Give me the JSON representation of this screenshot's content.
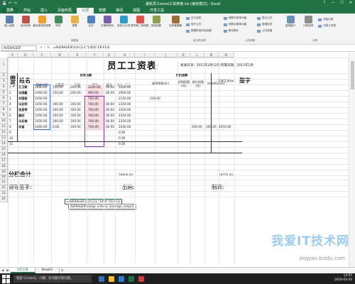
{
  "window": {
    "title": "最新员工excel工资表格.xls [兼容模式] - Excel",
    "qat_icons": [
      "save-icon",
      "undo-icon",
      "redo-icon"
    ],
    "controls": [
      "?",
      "—",
      "☐",
      "✕"
    ]
  },
  "ribbon_tabs": [
    "文件",
    "开始",
    "插入",
    "页面布局",
    "公式",
    "数据",
    "审阅",
    "视图",
    "开发工具"
  ],
  "ribbon_active_tab": "公式",
  "ribbon": {
    "buttons": [
      "插入函数",
      "自动求和",
      "最近使用的函数",
      "财务",
      "逻辑",
      "文本",
      "日期和时间",
      "查找与引用",
      "数学和三角函数",
      "其他函数",
      "名称管理器"
    ],
    "small_items": [
      "定义名称",
      "用于公式",
      "根据所选内容创建",
      "追踪引用单元格",
      "追踪从属单元格",
      "移去箭头",
      "显示公式",
      "错误检查",
      "公式求值",
      "监视窗口",
      "计算选项",
      "开始计算",
      "计算工作表"
    ],
    "groups": [
      "函数库",
      "定义的名称",
      "公式审核",
      "计算"
    ]
  },
  "formula_bar": {
    "name_box": "AVERAGEIF",
    "formula": "=AVERAGEIF(C4:C13,\"1450\",F6:F13)"
  },
  "columns": [
    "A",
    "B",
    "C",
    "D",
    "E",
    "F",
    "G",
    "H",
    "I",
    "J",
    "K",
    "L",
    "M",
    "N"
  ],
  "rows": [
    "1",
    "2",
    "3",
    "4",
    "5",
    "6",
    "7",
    "8",
    "9",
    "10",
    "11",
    "12",
    "13",
    "14",
    "15",
    "16",
    "17",
    "18",
    "19",
    "20",
    "21",
    "22",
    "23",
    "24"
  ],
  "sheet": {
    "title": "员工工资表",
    "issue_date": "发放日期：2015年2月12日",
    "period": "所属日期：2015年1月",
    "headers": {
      "no": "编号",
      "name": "姓名",
      "pay_group": "应发金额",
      "base": "基本工资",
      "full": "全勤奖",
      "bonus": "补助",
      "perf": "奖金",
      "prize": "奖金",
      "total": "合计（元）",
      "deduct_group": "应扣金额",
      "absent": "请假扣款(元)",
      "late": "迟到扣款(元)",
      "other": "其它扣款(元)",
      "deduct_total": "应扣合计(元)",
      "actual": "实发工资(元)",
      "sign": "签字"
    },
    "rows": [
      {
        "no": "1",
        "name": "王卫朝",
        "base": "1460.00",
        "full": "150.00",
        "bonus": "200.00",
        "perf": "1200.00",
        "prize": "00.00",
        "total": "3300.00",
        "absent": "",
        "late": "",
        "other": "",
        "ded": "",
        "actual": ""
      },
      {
        "no": "2",
        "name": "马国鑫",
        "base": "1460.00",
        "full": "150.00",
        "bonus": "200.00",
        "perf": "900.00",
        "prize": "00.00",
        "total": "2950.00",
        "absent": "",
        "late": "",
        "other": "",
        "ded": "",
        "actual": ""
      },
      {
        "no": "3",
        "name": "刘国俊",
        "base": "1450.00",
        "full": "",
        "bonus": "",
        "perf": "700.00",
        "prize": "",
        "total": "2150.00",
        "absent": "330.00",
        "late": "",
        "other": "",
        "ded": "",
        "actual": ""
      },
      {
        "no": "4",
        "name": "马亚明",
        "base": "1450.00",
        "full": "100.00",
        "bonus": "100.00",
        "perf": "700.00",
        "prize": "00.00",
        "total": "2350.00",
        "absent": "",
        "late": "",
        "other": "",
        "ded": "",
        "actual": ""
      },
      {
        "no": "5",
        "name": "张爱琴",
        "base": "1450.00",
        "full": "100.00",
        "bonus": "100.00",
        "perf": "700.00",
        "prize": "00.00",
        "total": "2350.00",
        "absent": "",
        "late": "",
        "other": "",
        "ded": "",
        "actual": ""
      },
      {
        "no": "6",
        "name": "冀阳",
        "base": "1450.00",
        "full": "100.00",
        "bonus": "100.00",
        "perf": "700.00",
        "prize": "00.00",
        "total": "2350.00",
        "absent": "",
        "late": "",
        "other": "",
        "ded": "",
        "actual": ""
      },
      {
        "no": "7",
        "name": "马亚梅",
        "base": "1450.00",
        "full": "100.00",
        "bonus": "100.00",
        "perf": "700.00",
        "prize": "00.00",
        "total": "2350.00",
        "absent": "",
        "late": "",
        "other": "",
        "ded": "",
        "actual": ""
      },
      {
        "no": "8",
        "name": "邓睿",
        "base": "1460.00",
        "full": "0.00",
        "bonus": "100.00",
        "perf": "700.00",
        "prize": "00.00",
        "total": "2260.00",
        "absent": "",
        "late": "",
        "other": "200.00",
        "ded": "200.00",
        "actual": "2050.00"
      },
      {
        "no": "9",
        "name": "",
        "base": "",
        "full": "",
        "bonus": "",
        "perf": "",
        "prize": "",
        "total": "0.00",
        "absent": "",
        "late": "",
        "other": "",
        "ded": "",
        "actual": ""
      },
      {
        "no": "10",
        "name": "",
        "base": "",
        "full": "",
        "bonus": "",
        "perf": "",
        "prize": "",
        "total": "0.00",
        "absent": "",
        "late": "",
        "other": "",
        "ded": "",
        "actual": ""
      },
      {
        "no": "11",
        "name": "",
        "base": "",
        "full": "",
        "bonus": "",
        "perf": "",
        "prize": "",
        "total": "0.00",
        "absent": "",
        "late": "",
        "other": "",
        "ded": "",
        "actual": ""
      }
    ],
    "subtotal_label": "分栏合计",
    "subtotal_total": "18600.00",
    "subtotal_actual": "18770.00",
    "sign_leader": "领导签字:",
    "sign_cashier": "出纳:",
    "sign_maker": "制表:",
    "edit_cell_text": "=AVERAGEIF(C4:C13,\"1450\",F6:F13)",
    "tooltip": "AVERAGEIF(range, criteria, [average_range])"
  },
  "sheet_tabs": [
    "5月工资",
    "Sheet3"
  ],
  "taskbar": {
    "search": "我是 Cortana，小娜。有问题尽管问我。",
    "time": "14:55",
    "date": "2016-03-10"
  },
  "watermark": {
    "text": "我爱IT技术网",
    "url": "jingyan.baidu.com"
  },
  "colors": {
    "excel_green": "#217346",
    "selection_purple": "#8a2fa8",
    "highlight_pink": "#f8dce4",
    "watermark_blue": "#288cd2"
  }
}
